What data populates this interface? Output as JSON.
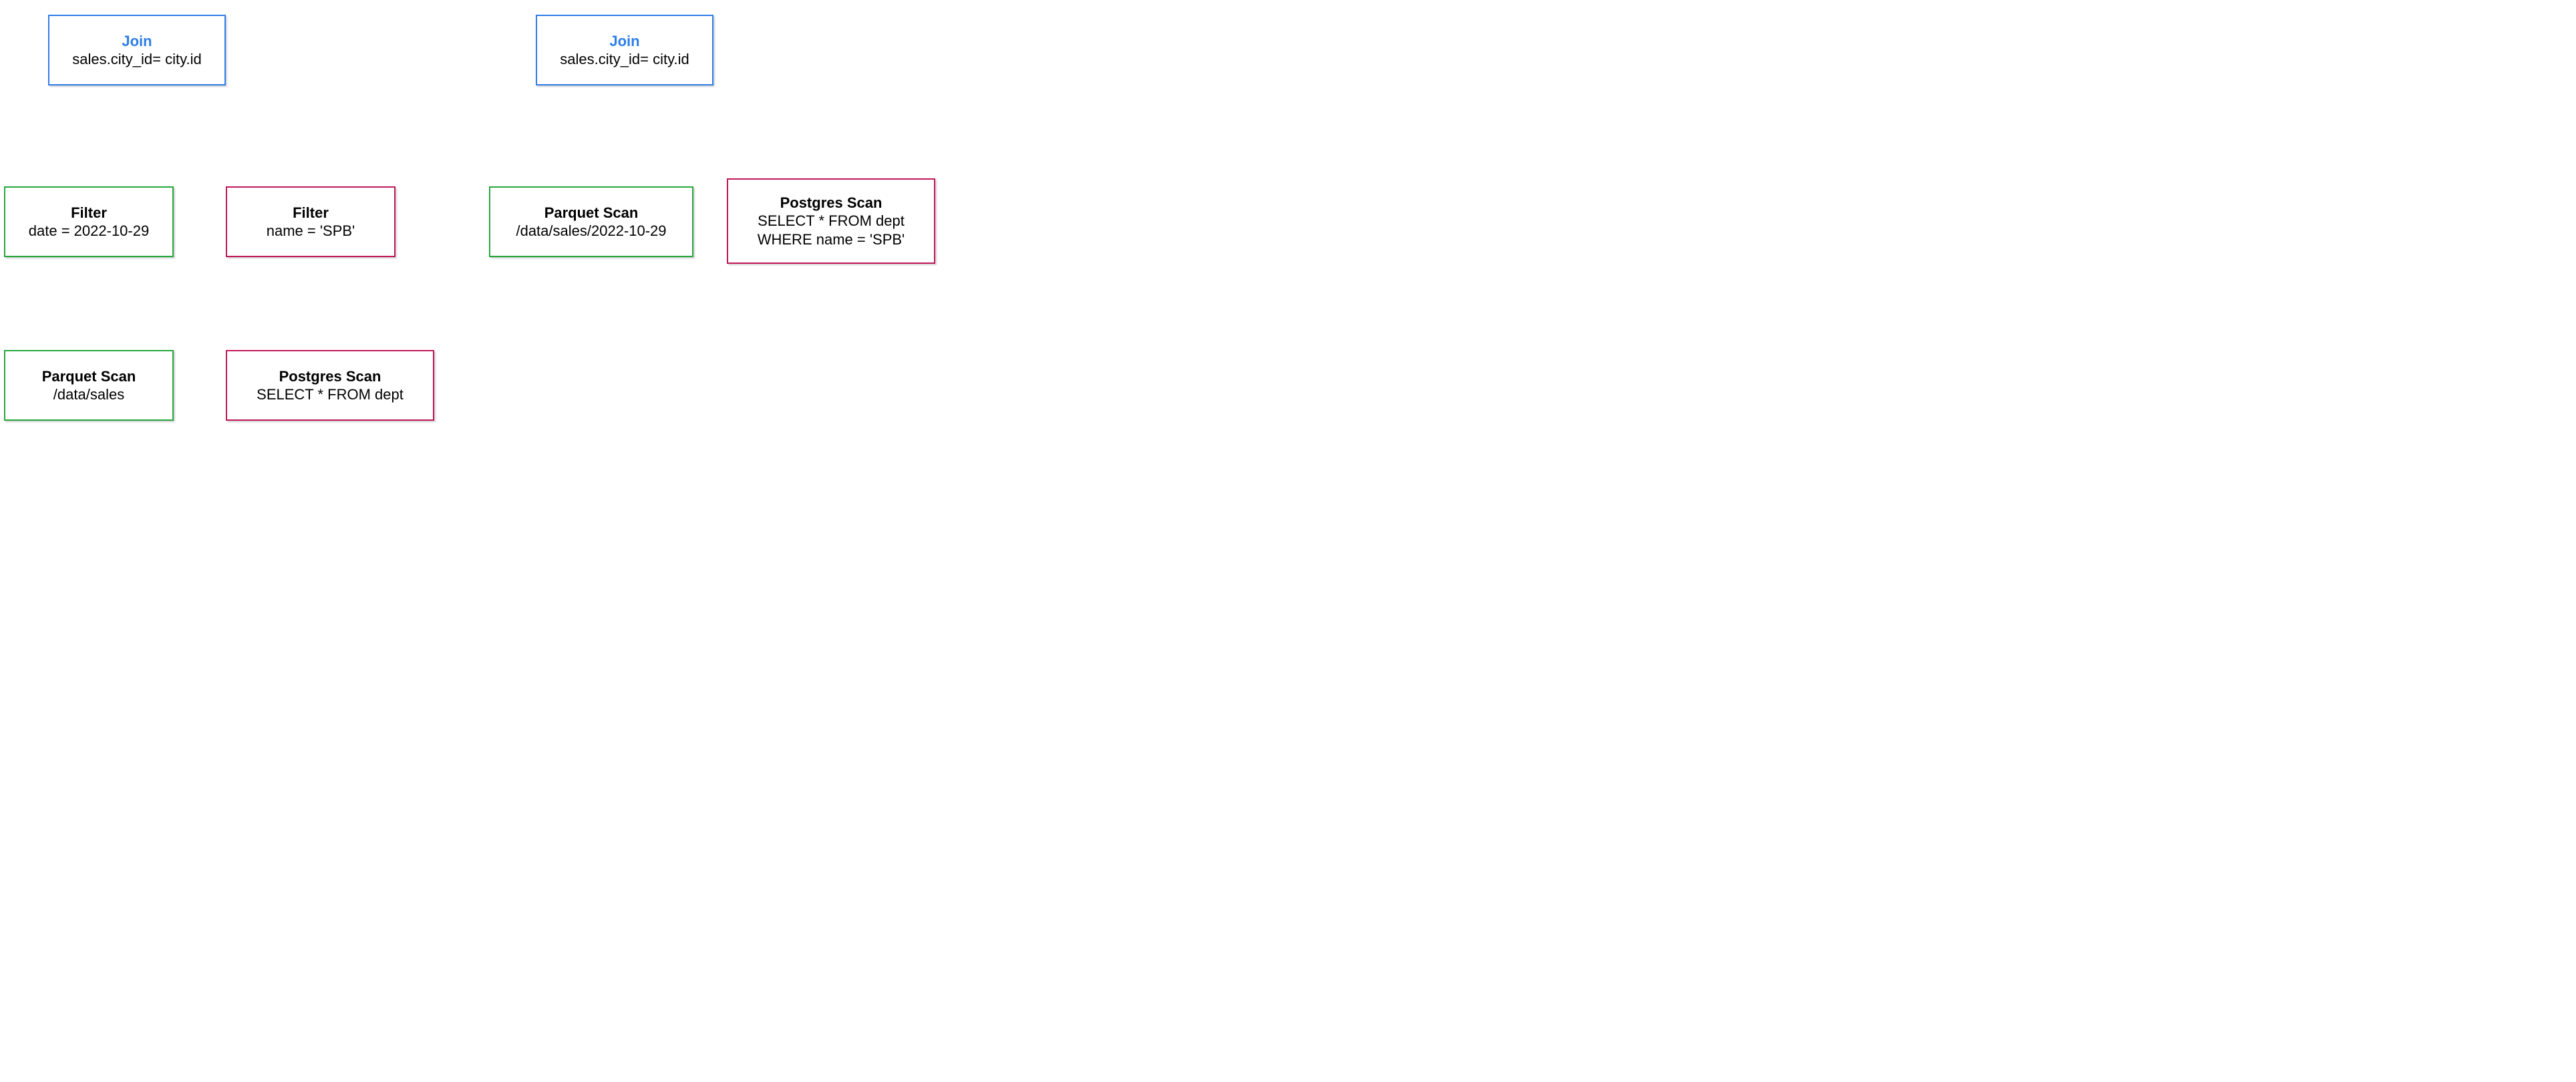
{
  "colors": {
    "blue": "#2e7de9",
    "green": "#26a63a",
    "pink": "#c2185b",
    "black": "#000000"
  },
  "left": {
    "join": {
      "title": "Join",
      "sub": "sales.city_id= city.id"
    },
    "filterParquet": {
      "title": "Filter",
      "sub": "date = 2022-10-29"
    },
    "filterPostgres": {
      "title": "Filter",
      "sub": "name = 'SPB'"
    },
    "parquetScan": {
      "title": "Parquet Scan",
      "sub": "/data/sales"
    },
    "postgresScan": {
      "title": "Postgres Scan",
      "sub": "SELECT * FROM dept"
    }
  },
  "right": {
    "join": {
      "title": "Join",
      "sub": "sales.city_id= city.id"
    },
    "parquetScan": {
      "title": "Parquet Scan",
      "sub": "/data/sales/2022-10-29"
    },
    "postgresScan": {
      "title": "Postgres Scan",
      "sub1": "SELECT * FROM dept",
      "sub2": "WHERE name = 'SPB'"
    }
  }
}
